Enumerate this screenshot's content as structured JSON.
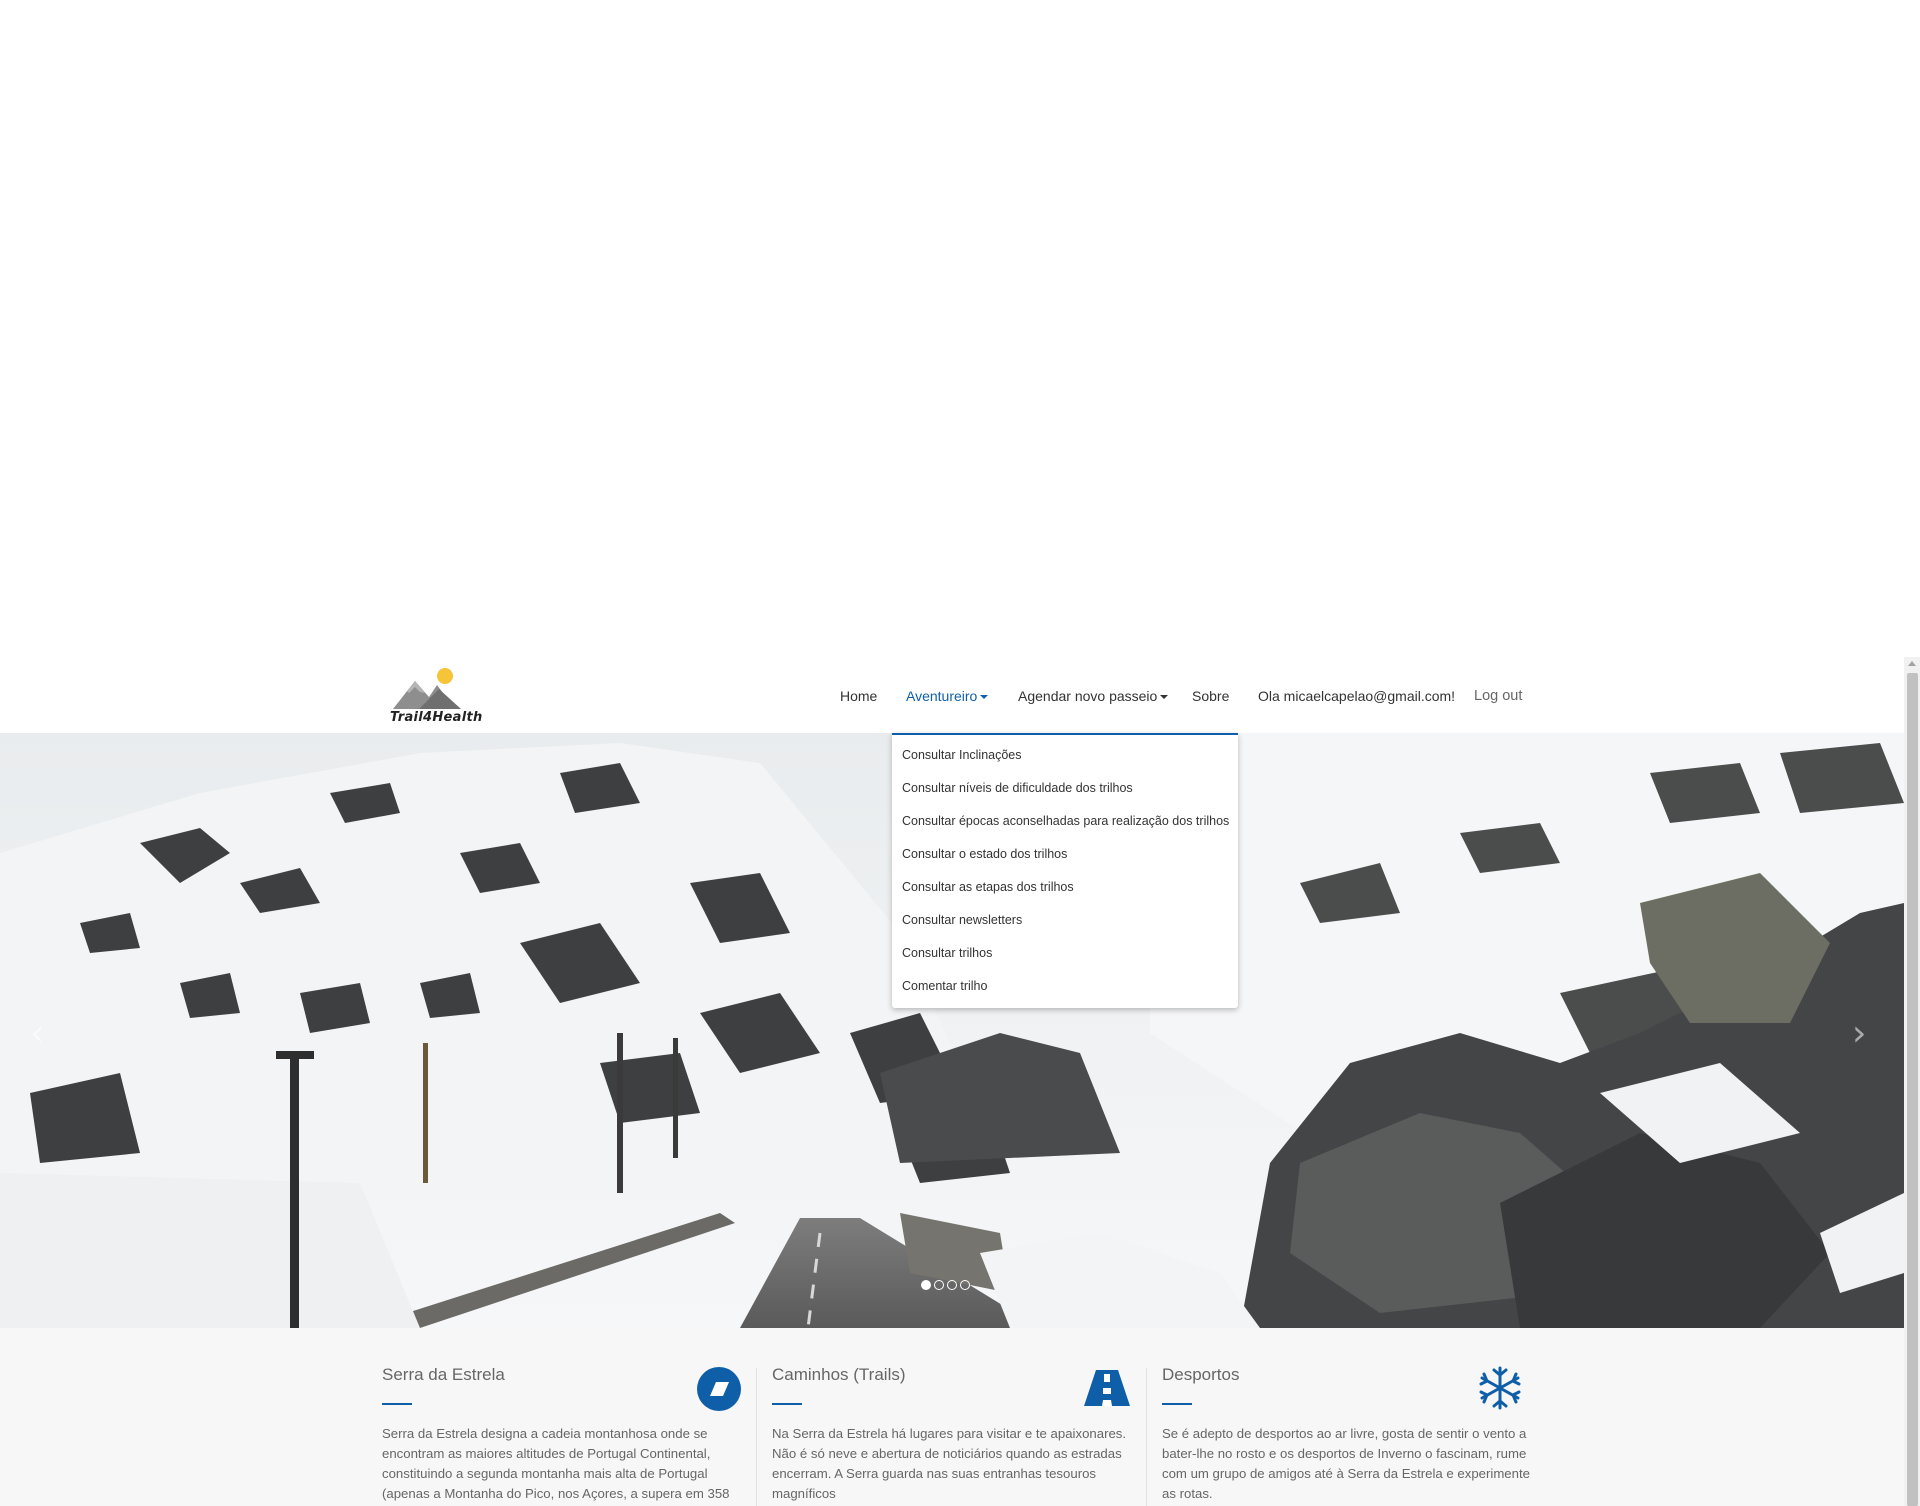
{
  "brand": {
    "logo_text": "Trail4Health"
  },
  "nav": {
    "home": "Home",
    "aventureiro": "Aventureiro",
    "agendar": "Agendar novo passeio",
    "sobre": "Sobre",
    "greeting": "Ola micaelcapelao@gmail.com!",
    "logout": "Log out"
  },
  "dropdown": {
    "items": [
      "Consultar Inclinações",
      "Consultar níveis de dificuldade dos trilhos",
      "Consultar épocas aconselhadas para realização dos trilhos",
      "Consultar o estado dos trilhos",
      "Consultar as etapas dos trilhos",
      "Consultar newsletters",
      "Consultar trilhos",
      "Comentar trilho"
    ]
  },
  "carousel": {
    "prev_glyph": "‹",
    "next_glyph": "›",
    "slide_count": 4,
    "active_index": 0
  },
  "features": [
    {
      "title": "Serra da Estrela",
      "icon": "tag-icon",
      "text": "Serra da Estrela designa a cadeia montanhosa onde se encontram as maiores altitudes de Portugal Continental, constituindo a segunda montanha mais alta de Portugal (apenas a Montanha do Pico, nos Açores, a supera em 358"
    },
    {
      "title": "Caminhos (Trails)",
      "icon": "road-icon",
      "text": "Na Serra da Estrela há lugares para visitar e te apaixonares. Não é só neve e abertura de noticiários quando as estradas encerram. A Serra guarda nas suas entranhas tesouros magníficos"
    },
    {
      "title": "Desportos",
      "icon": "snowflake-icon",
      "text": "Se é adepto de desportos ao ar livre, gosta de sentir o vento a bater-lhe no rosto e os desportos de Inverno o fascinam, rume com um grupo de amigos até à Serra da Estrela e experimente as rotas."
    }
  ],
  "colors": {
    "accent": "#0f5fa8",
    "features_bg": "#f7f7f7",
    "sun": "#f6c437"
  }
}
